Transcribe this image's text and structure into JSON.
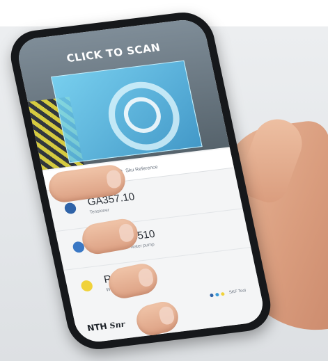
{
  "app": {
    "hero_title": "CLICK TO SCAN",
    "search_label": "Sku Reference",
    "items": [
      {
        "ref": "GA357.10",
        "desc": "Tensioner",
        "dot_color": "#2f63a8"
      },
      {
        "ref": "KDP459.510",
        "desc": "Timing belt kit + water pump",
        "dot_color": "#3a78c5"
      },
      {
        "ref": "R157.32",
        "desc": "Wheel bearing kit",
        "dot_color": "#f0d23a"
      }
    ],
    "pager_label": "SKF Tool",
    "pager_colors": [
      "#2f63a8",
      "#3a9ad8",
      "#f0d23a"
    ],
    "brand": "NTH",
    "brand_script": "Snr"
  },
  "colors": {
    "scan_box": "#5ec4ee",
    "stripe_yellow": "#e2d53a",
    "skin": "#e3a98a"
  }
}
